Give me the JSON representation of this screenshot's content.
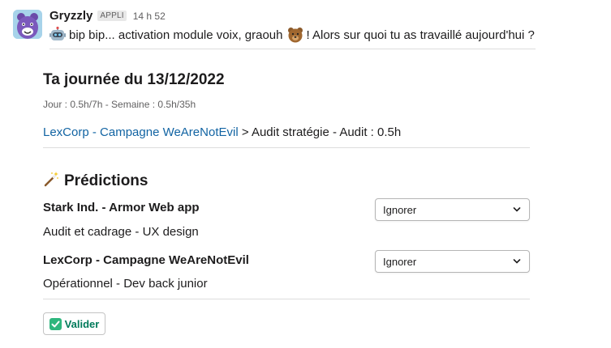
{
  "message": {
    "sender": "Gryzzly",
    "badge": "APPLI",
    "time": "14 h 52",
    "icon_robot": "robot-icon",
    "text_before": "bip bip... activation module voix, graouh",
    "icon_bear": "bear-icon",
    "text_after": "! Alors sur quoi tu as travaillé aujourd'hui ?"
  },
  "day": {
    "title": "Ta journée du 13/12/2022",
    "stats": "Jour : 0.5h/7h - Semaine : 0.5h/35h",
    "entry_link": "LexCorp - Campagne WeAreNotEvil",
    "entry_rest": " > Audit stratégie - Audit : 0.5h"
  },
  "predictions": {
    "icon": "magic-wand-icon",
    "title": "Prédictions",
    "items": [
      {
        "project": "Stark Ind. - Armor Web app",
        "task": "Audit et cadrage - UX design",
        "select_value": "Ignorer"
      },
      {
        "project": "LexCorp - Campagne WeAreNotEvil",
        "task": "Opérationnel - Dev back junior",
        "select_value": "Ignorer"
      }
    ]
  },
  "actions": {
    "submit_icon": "check-icon",
    "submit_label": "Valider"
  },
  "colors": {
    "link": "#1264a3",
    "submit_text": "#007a5a",
    "check_bg": "#2eb67d"
  }
}
